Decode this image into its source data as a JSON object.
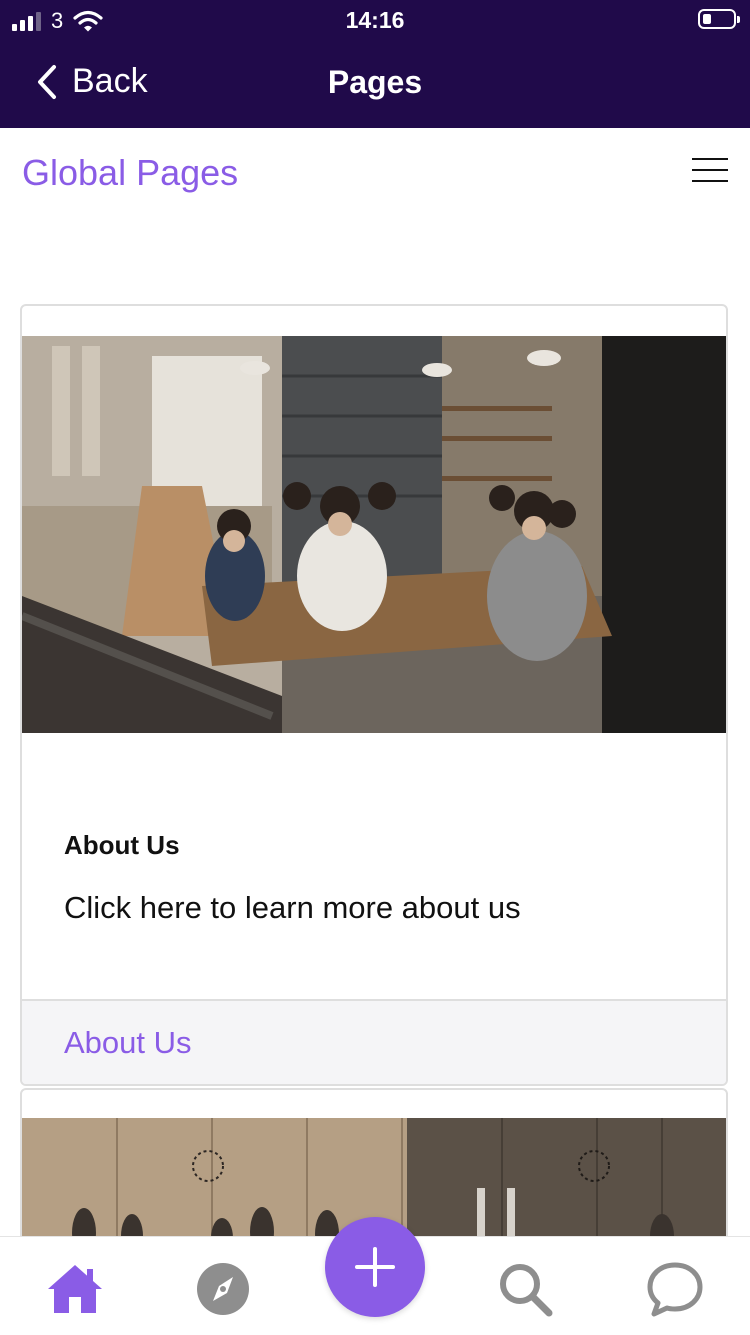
{
  "status_bar": {
    "carrier": "3",
    "time": "14:16"
  },
  "nav": {
    "back_label": "Back",
    "title": "Pages"
  },
  "page": {
    "title": "Global Pages"
  },
  "cards": [
    {
      "title": "About Us",
      "description": "Click here to learn more about us",
      "link_label": "About Us"
    }
  ],
  "tabs": [
    {
      "icon": "home-icon"
    },
    {
      "icon": "compass-icon"
    },
    {
      "icon": "plus-icon"
    },
    {
      "icon": "search-icon"
    },
    {
      "icon": "chat-bubble-icon"
    }
  ],
  "colors": {
    "header_bg": "#200a4a",
    "accent": "#8a5ce6",
    "inactive_icon": "#8e8e8e"
  }
}
